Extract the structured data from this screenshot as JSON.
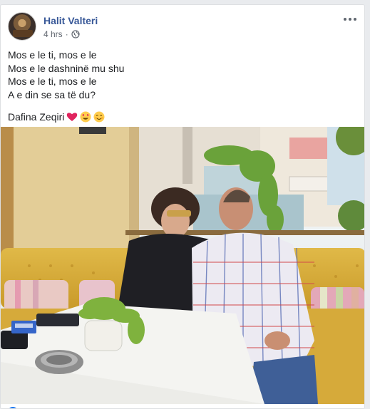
{
  "post": {
    "author": "Halit Valteri",
    "time": "4 hrs",
    "time_separator": "·",
    "lines": [
      "Mos e le ti, mos e le",
      "Mos e le dashninë mu shu",
      "Mos e le ti, mos e le",
      "A e din se sa të du?"
    ],
    "tag_text": "Dafina Zeqiri",
    "emojis": [
      "red-heart-emoji",
      "heart-eyes-emoji",
      "smiling-face-emoji"
    ],
    "audience_icon": "globe-icon",
    "more_icon": "more-horizontal-icon"
  },
  "photo": {
    "description_colors": {
      "sofa": "#d9b23c",
      "wall": "#e2cf9a",
      "table": "#f5f5f2",
      "building": "#f3ece3"
    }
  },
  "theme": {
    "author_color": "#385898",
    "meta_color": "#616770",
    "text_color": "#1c1e21"
  }
}
